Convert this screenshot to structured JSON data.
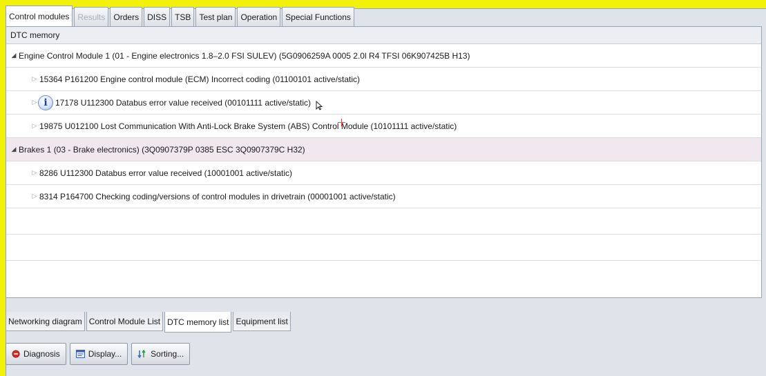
{
  "top_tabs": [
    {
      "label": "Control modules",
      "state": "active"
    },
    {
      "label": "Results",
      "state": "disabled"
    },
    {
      "label": "Orders",
      "state": "normal"
    },
    {
      "label": "DISS",
      "state": "normal"
    },
    {
      "label": "TSB",
      "state": "normal"
    },
    {
      "label": "Test plan",
      "state": "normal"
    },
    {
      "label": "Operation",
      "state": "normal"
    },
    {
      "label": "Special Functions",
      "state": "normal"
    }
  ],
  "panel": {
    "header": "DTC memory",
    "groups": [
      {
        "label": "Engine Control Module 1 (01 - Engine electronics 1.8–2.0 FSI SULEV) (5G0906259A   0005  2.0l R4 TFSI    06K907425B   H13)",
        "expanded_icon": "triangle-down-icon",
        "dtcs": [
          {
            "text": "15364  P161200  Engine control module (ECM) Incorrect coding  (01100101  active/static)"
          },
          {
            "text": "17178  U112300  Databus error value received  (00101111  active/static)",
            "info_icon": "info-icon"
          },
          {
            "text": "19875  U012100  Lost Communication With Anti-Lock Brake System (ABS) Control Module  (10101111  active/static)"
          }
        ]
      },
      {
        "label": "Brakes 1 (03 - Brake electronics) (3Q0907379P   0385  ESC              3Q0907379C   H32)",
        "expanded_icon": "triangle-down-icon",
        "dtcs": [
          {
            "text": "8286  U112300  Databus error value received  (10001001  active/static)"
          },
          {
            "text": "8314  P164700  Checking coding/versions of control modules in drivetrain  (00001001  active/static)"
          }
        ]
      }
    ]
  },
  "bottom_tabs": [
    {
      "label": "Networking diagram",
      "state": "normal"
    },
    {
      "label": "Control Module List",
      "state": "normal"
    },
    {
      "label": "DTC memory list",
      "state": "active"
    },
    {
      "label": "Equipment list",
      "state": "normal"
    }
  ],
  "buttons": {
    "diagnosis": {
      "label": "Diagnosis",
      "icon": "red-circle-icon"
    },
    "display": {
      "label": "Display...",
      "icon": "display-window-icon"
    },
    "sorting": {
      "label": "Sorting...",
      "icon": "sort-icon"
    }
  },
  "colors": {
    "outer_frame": "#f2f10a",
    "selected_group_highlight": "#f1e8ef",
    "disabled_tab_text": "#a9b0ba"
  }
}
